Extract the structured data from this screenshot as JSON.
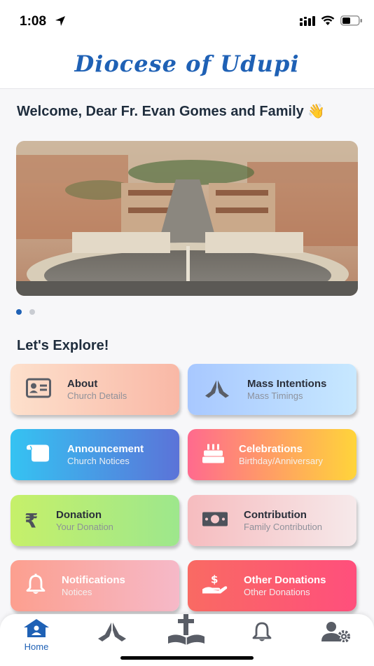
{
  "status_bar": {
    "time": "1:08"
  },
  "header": {
    "title": "Diocese of Udupi"
  },
  "welcome": {
    "text": "Welcome, Dear Fr. Evan Gomes and Family 👋"
  },
  "carousel": {
    "dot_count": 2,
    "active_index": 0
  },
  "explore": {
    "title": "Let's Explore!",
    "cards": [
      {
        "title": "About",
        "subtitle": "Church Details",
        "icon": "id-card-icon"
      },
      {
        "title": "Mass Intentions",
        "subtitle": "Mass Timings",
        "icon": "praying-hands-icon"
      },
      {
        "title": "Announcement",
        "subtitle": "Church Notices",
        "icon": "scroll-icon"
      },
      {
        "title": "Celebrations",
        "subtitle": "Birthday/Anniversary",
        "icon": "cake-icon"
      },
      {
        "title": "Donation",
        "subtitle": "Your Donation",
        "icon": "rupee-icon"
      },
      {
        "title": "Contribution",
        "subtitle": "Family Contribution",
        "icon": "money-bill-icon"
      },
      {
        "title": "Notifications",
        "subtitle": "Notices",
        "icon": "bell-icon"
      },
      {
        "title": "Other Donations",
        "subtitle": "Other Donations",
        "icon": "hand-holding-dollar-icon"
      }
    ]
  },
  "bottom_nav": {
    "items": [
      {
        "label": "Home",
        "icon": "home-icon",
        "active": true
      },
      {
        "label": "",
        "icon": "praying-hands-icon"
      },
      {
        "label": "",
        "icon": "bible-cross-icon"
      },
      {
        "label": "",
        "icon": "bell-icon"
      },
      {
        "label": "",
        "icon": "user-settings-icon"
      }
    ]
  },
  "colors": {
    "brand": "#1f61b5",
    "active_dot": "#1f61b5",
    "inactive_dot": "#c9ccd2",
    "icon_gray": "#595d66"
  }
}
